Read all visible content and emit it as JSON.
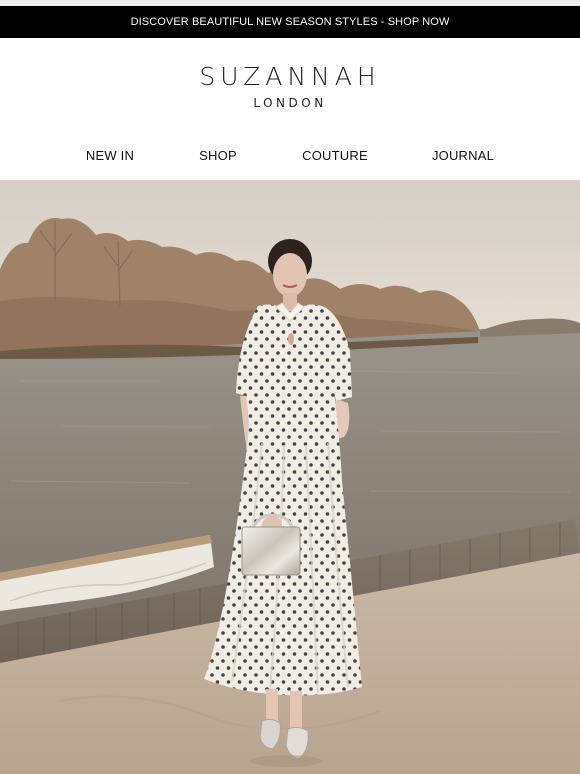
{
  "promo": {
    "text": "DISCOVER BEAUTIFUL NEW SEASON STYLES - SHOP NOW"
  },
  "brand": {
    "name": "SUZANNAH",
    "sub": "LONDON"
  },
  "nav": {
    "items": [
      {
        "label": "NEW IN"
      },
      {
        "label": "SHOP"
      },
      {
        "label": "COUTURE"
      },
      {
        "label": "JOURNAL"
      }
    ]
  },
  "colors": {
    "promo_bg": "#000000",
    "promo_text": "#ffffff",
    "sky": "#ddd5cb",
    "river": "#8c8479",
    "dock": "#7b7065",
    "sand": "#c8b7a3",
    "dress": "#f1ede4",
    "dots": "#24242e"
  }
}
